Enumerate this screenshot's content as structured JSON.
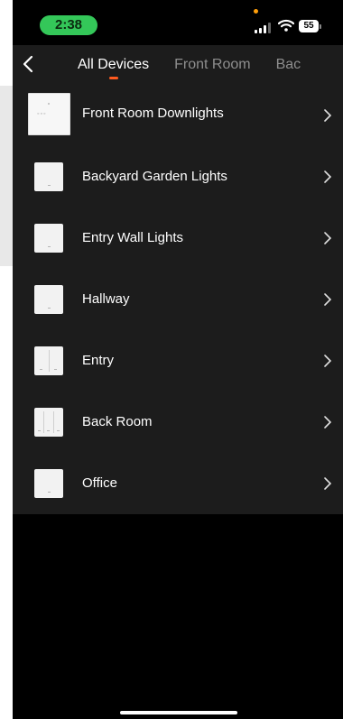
{
  "status_bar": {
    "time": "2:38",
    "battery": "55",
    "icons": [
      "signal-icon",
      "wifi-icon",
      "battery-icon"
    ]
  },
  "header": {
    "back_icon": "chevron-left-icon",
    "tabs": [
      {
        "label": "All Devices",
        "active": true
      },
      {
        "label": "Front Room",
        "active": false
      },
      {
        "label": "Bac",
        "active": false
      }
    ]
  },
  "devices": [
    {
      "name": "Front Room Downlights",
      "thumbnail": "triple-switch-panel"
    },
    {
      "name": "Backyard Garden Lights",
      "thumbnail": "single-switch"
    },
    {
      "name": "Entry Wall Lights",
      "thumbnail": "single-switch"
    },
    {
      "name": "Hallway",
      "thumbnail": "single-switch"
    },
    {
      "name": "Entry",
      "thumbnail": "double-switch"
    },
    {
      "name": "Back Room",
      "thumbnail": "triple-switch"
    },
    {
      "name": "Office",
      "thumbnail": "single-switch"
    }
  ],
  "colors": {
    "accent": "#ff5a1f",
    "time_pill": "#34c759",
    "panel_bg": "#1c1c1c",
    "screen_bg": "#000000"
  }
}
